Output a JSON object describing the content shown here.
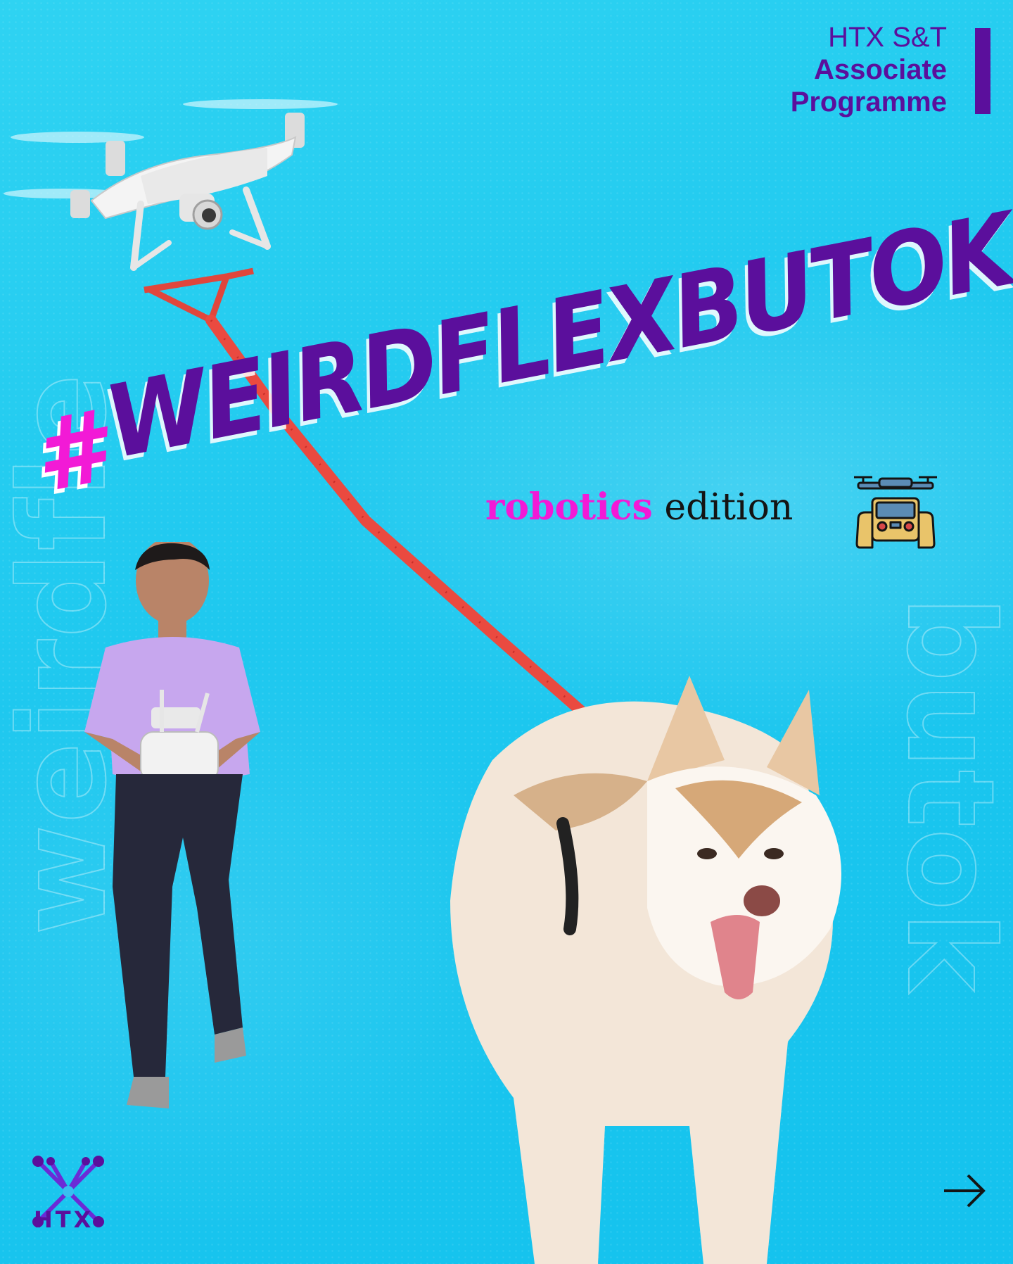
{
  "header": {
    "line1": "HTX S&T",
    "line2": "Associate",
    "line3": "Programme"
  },
  "hashtag": {
    "symbol": "#",
    "word": "WEIRDFLEXBUTOK"
  },
  "edition": {
    "highlight": "robotics",
    "rest": " edition"
  },
  "watermark": {
    "left": "weirdfle",
    "right": "butok"
  },
  "logo": {
    "text": "HTX"
  },
  "icons": {
    "controller": "drone-controller-icon",
    "next": "arrow-right-icon"
  },
  "colors": {
    "background": "#1ec8ef",
    "purple": "#5b0f9c",
    "magenta": "#f21ad6",
    "leash": "#e8453c"
  }
}
